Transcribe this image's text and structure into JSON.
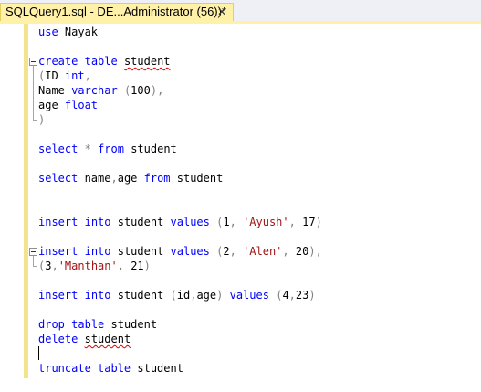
{
  "tab": {
    "title": "SQLQuery1.sql - DE...Administrator (56))*",
    "close_glyph": "✕"
  },
  "code_lines": [
    {
      "row": 0,
      "fold": false,
      "tokens": [
        {
          "t": "use",
          "c": "kw"
        },
        {
          "t": " Nayak",
          "c": ""
        }
      ]
    },
    {
      "row": 2,
      "fold": true,
      "tokens": [
        {
          "t": "create",
          "c": "kw"
        },
        {
          "t": " ",
          "c": ""
        },
        {
          "t": "table",
          "c": "kw"
        },
        {
          "t": " ",
          "c": ""
        },
        {
          "t": "student",
          "c": "squig"
        }
      ]
    },
    {
      "row": 3,
      "fold": false,
      "tokens": [
        {
          "t": "(",
          "c": "gray"
        },
        {
          "t": "ID ",
          "c": ""
        },
        {
          "t": "int",
          "c": "kw"
        },
        {
          "t": ",",
          "c": "gray"
        }
      ]
    },
    {
      "row": 4,
      "fold": false,
      "tokens": [
        {
          "t": "Name ",
          "c": ""
        },
        {
          "t": "varchar",
          "c": "kw"
        },
        {
          "t": " ",
          "c": ""
        },
        {
          "t": "(",
          "c": "gray"
        },
        {
          "t": "100",
          "c": ""
        },
        {
          "t": "),",
          "c": "gray"
        }
      ]
    },
    {
      "row": 5,
      "fold": false,
      "tokens": [
        {
          "t": "age ",
          "c": ""
        },
        {
          "t": "float",
          "c": "kw"
        }
      ]
    },
    {
      "row": 6,
      "fold": false,
      "tokens": [
        {
          "t": ")",
          "c": "gray"
        }
      ]
    },
    {
      "row": 8,
      "fold": false,
      "tokens": [
        {
          "t": "select",
          "c": "kw"
        },
        {
          "t": " ",
          "c": ""
        },
        {
          "t": "*",
          "c": "gray"
        },
        {
          "t": " ",
          "c": ""
        },
        {
          "t": "from",
          "c": "kw"
        },
        {
          "t": " student",
          "c": ""
        }
      ]
    },
    {
      "row": 10,
      "fold": false,
      "tokens": [
        {
          "t": "select",
          "c": "kw"
        },
        {
          "t": " name",
          "c": ""
        },
        {
          "t": ",",
          "c": "gray"
        },
        {
          "t": "age ",
          "c": ""
        },
        {
          "t": "from",
          "c": "kw"
        },
        {
          "t": " student",
          "c": ""
        }
      ]
    },
    {
      "row": 13,
      "fold": false,
      "tokens": [
        {
          "t": "insert",
          "c": "kw"
        },
        {
          "t": " ",
          "c": ""
        },
        {
          "t": "into",
          "c": "kw"
        },
        {
          "t": " student ",
          "c": ""
        },
        {
          "t": "values",
          "c": "kw"
        },
        {
          "t": " ",
          "c": ""
        },
        {
          "t": "(",
          "c": "gray"
        },
        {
          "t": "1",
          "c": ""
        },
        {
          "t": ",",
          "c": "gray"
        },
        {
          "t": " ",
          "c": ""
        },
        {
          "t": "'Ayush'",
          "c": "str"
        },
        {
          "t": ",",
          "c": "gray"
        },
        {
          "t": " 17",
          "c": ""
        },
        {
          "t": ")",
          "c": "gray"
        }
      ]
    },
    {
      "row": 15,
      "fold": true,
      "tokens": [
        {
          "t": "insert",
          "c": "kw"
        },
        {
          "t": " ",
          "c": ""
        },
        {
          "t": "into",
          "c": "kw"
        },
        {
          "t": " student ",
          "c": ""
        },
        {
          "t": "values",
          "c": "kw"
        },
        {
          "t": " ",
          "c": ""
        },
        {
          "t": "(",
          "c": "gray"
        },
        {
          "t": "2",
          "c": ""
        },
        {
          "t": ",",
          "c": "gray"
        },
        {
          "t": " ",
          "c": ""
        },
        {
          "t": "'Alen'",
          "c": "str"
        },
        {
          "t": ",",
          "c": "gray"
        },
        {
          "t": " 20",
          "c": ""
        },
        {
          "t": "),",
          "c": "gray"
        }
      ]
    },
    {
      "row": 16,
      "fold": false,
      "tokens": [
        {
          "t": "(",
          "c": "gray"
        },
        {
          "t": "3",
          "c": ""
        },
        {
          "t": ",",
          "c": "gray"
        },
        {
          "t": "'Manthan'",
          "c": "str"
        },
        {
          "t": ",",
          "c": "gray"
        },
        {
          "t": " 21",
          "c": ""
        },
        {
          "t": ")",
          "c": "gray"
        }
      ]
    },
    {
      "row": 18,
      "fold": false,
      "tokens": [
        {
          "t": "insert",
          "c": "kw"
        },
        {
          "t": " ",
          "c": ""
        },
        {
          "t": "into",
          "c": "kw"
        },
        {
          "t": " student ",
          "c": ""
        },
        {
          "t": "(",
          "c": "gray"
        },
        {
          "t": "id",
          "c": ""
        },
        {
          "t": ",",
          "c": "gray"
        },
        {
          "t": "age",
          "c": ""
        },
        {
          "t": ")",
          "c": "gray"
        },
        {
          "t": " ",
          "c": ""
        },
        {
          "t": "values",
          "c": "kw"
        },
        {
          "t": " ",
          "c": ""
        },
        {
          "t": "(",
          "c": "gray"
        },
        {
          "t": "4",
          "c": ""
        },
        {
          "t": ",",
          "c": "gray"
        },
        {
          "t": "23",
          "c": ""
        },
        {
          "t": ")",
          "c": "gray"
        }
      ]
    },
    {
      "row": 20,
      "fold": false,
      "tokens": [
        {
          "t": "drop",
          "c": "kw"
        },
        {
          "t": " ",
          "c": ""
        },
        {
          "t": "table",
          "c": "kw"
        },
        {
          "t": " student",
          "c": ""
        }
      ]
    },
    {
      "row": 21,
      "fold": false,
      "tokens": [
        {
          "t": "delete",
          "c": "kw"
        },
        {
          "t": " ",
          "c": ""
        },
        {
          "t": "student",
          "c": "squig"
        }
      ]
    },
    {
      "row": 23,
      "fold": false,
      "tokens": [
        {
          "t": "truncate",
          "c": "kw"
        },
        {
          "t": " ",
          "c": ""
        },
        {
          "t": "table",
          "c": "kw"
        },
        {
          "t": " student",
          "c": ""
        }
      ]
    }
  ],
  "caret_row": 22,
  "colors": {
    "keyword": "#0000ff",
    "string": "#a31515",
    "operator": "#808080",
    "tab_active": "#fff1a8",
    "change_bar": "#f3e48c"
  }
}
